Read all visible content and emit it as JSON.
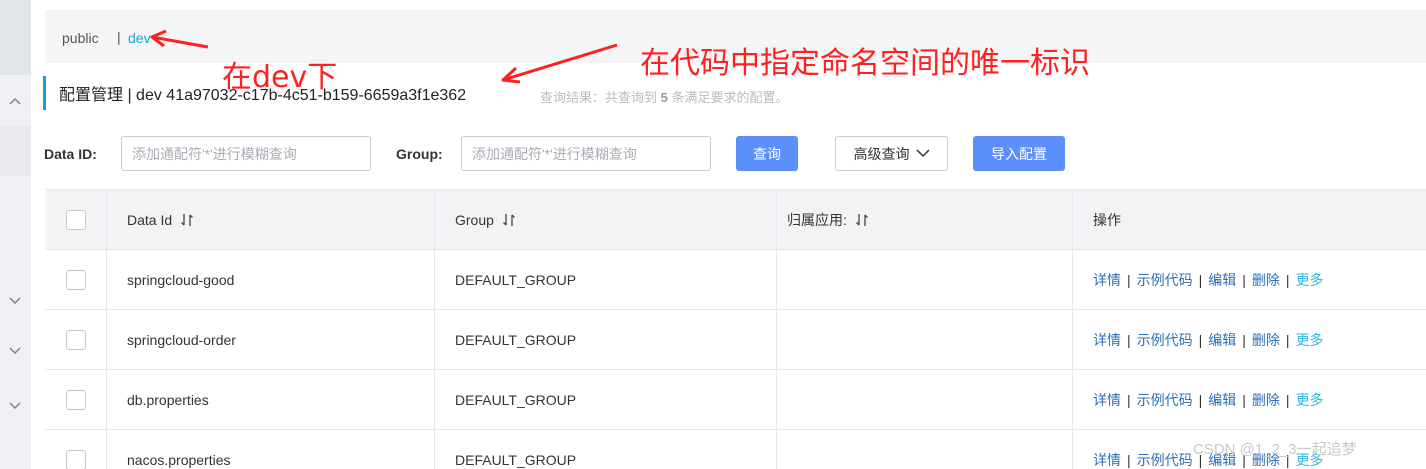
{
  "namespace": {
    "items": [
      "public",
      "dev"
    ],
    "separator": "|",
    "active": "dev"
  },
  "title": {
    "text": "配置管理 | dev 41a97032-c17b-4c51-b159-6659a3f1e362",
    "query_prefix": "查询结果：共查询到",
    "query_count": "5",
    "query_suffix": "条满足要求的配置。"
  },
  "filters": {
    "data_id_label": "Data ID:",
    "data_id_placeholder": "添加通配符'*'进行模糊查询",
    "group_label": "Group:",
    "group_placeholder": "添加通配符'*'进行模糊查询",
    "search_button": "查询",
    "advanced_button": "高级查询",
    "import_button": "导入配置"
  },
  "table": {
    "columns": [
      "Data Id",
      "Group",
      "归属应用:",
      "操作"
    ],
    "rows": [
      {
        "data_id": "springcloud-good",
        "group": "DEFAULT_GROUP",
        "app": ""
      },
      {
        "data_id": "springcloud-order",
        "group": "DEFAULT_GROUP",
        "app": ""
      },
      {
        "data_id": "db.properties",
        "group": "DEFAULT_GROUP",
        "app": ""
      },
      {
        "data_id": "nacos.properties",
        "group": "DEFAULT_GROUP",
        "app": ""
      }
    ],
    "actions": [
      "详情",
      "示例代码",
      "编辑",
      "删除",
      "更多"
    ]
  },
  "annotations": {
    "left": "在dev下",
    "right": "在代码中指定命名空间的唯一标识",
    "color": "#ff2020"
  },
  "watermark": "CSDN @1_2_3一起追梦",
  "colors": {
    "primary": "#5b8ff9",
    "accent": "#1aa3d9",
    "link": "#2a6fb5"
  }
}
